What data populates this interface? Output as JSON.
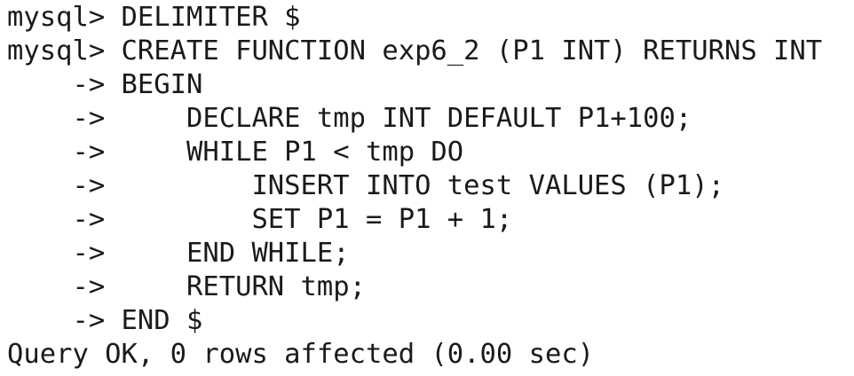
{
  "terminal": {
    "lines": [
      "mysql> DELIMITER $",
      "mysql> CREATE FUNCTION exp6_2 (P1 INT) RETURNS INT",
      "    -> BEGIN",
      "    ->     DECLARE tmp INT DEFAULT P1+100;",
      "    ->     WHILE P1 < tmp DO",
      "    ->         INSERT INTO test VALUES (P1);",
      "    ->         SET P1 = P1 + 1;",
      "    ->     END WHILE;",
      "    ->     RETURN tmp;",
      "    -> END $",
      "Query OK, 0 rows affected (0.00 sec)"
    ]
  }
}
